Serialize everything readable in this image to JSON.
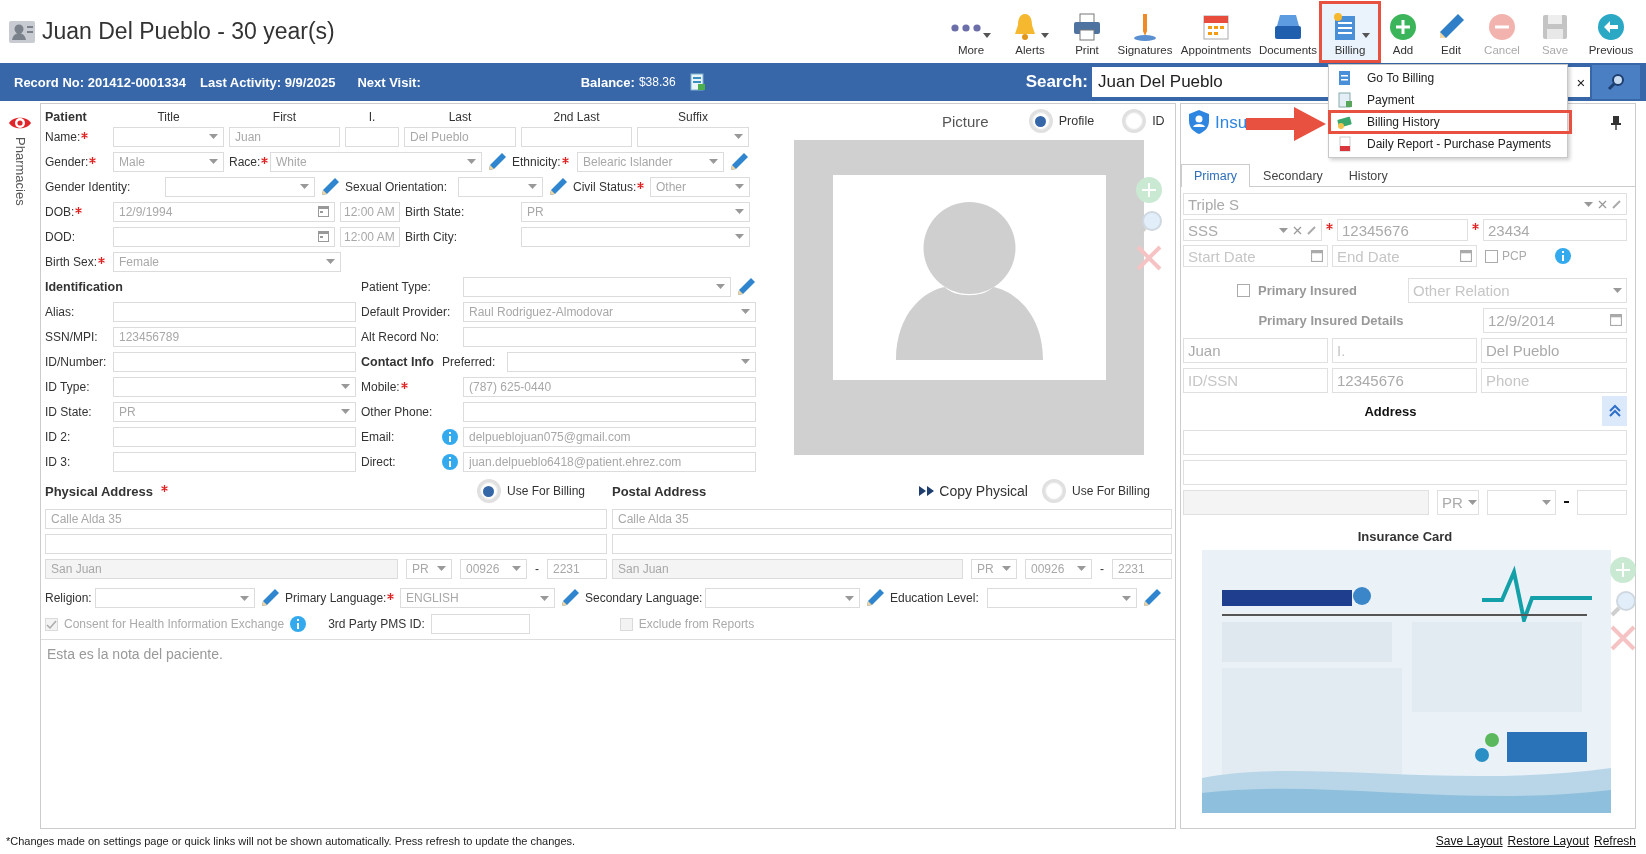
{
  "window": {
    "title": "Juan Del Pueblo - 30 year(s)"
  },
  "toolbar": [
    {
      "kind": "more",
      "label": "More",
      "caret": true,
      "disabled": false,
      "highlighted": false
    },
    {
      "kind": "alerts",
      "label": "Alerts",
      "caret": true,
      "disabled": false,
      "highlighted": false
    },
    {
      "kind": "print",
      "label": "Print",
      "caret": false,
      "disabled": false,
      "highlighted": false
    },
    {
      "kind": "signatures",
      "label": "Signatures",
      "caret": false,
      "disabled": false,
      "highlighted": false
    },
    {
      "kind": "appointments",
      "label": "Appointments",
      "caret": false,
      "disabled": false,
      "highlighted": false
    },
    {
      "kind": "documents",
      "label": "Documents",
      "caret": false,
      "disabled": false,
      "highlighted": false
    },
    {
      "kind": "billing",
      "label": "Billing",
      "caret": true,
      "disabled": false,
      "highlighted": true
    },
    {
      "kind": "add",
      "label": "Add",
      "caret": false,
      "disabled": false,
      "highlighted": false
    },
    {
      "kind": "edit",
      "label": "Edit",
      "caret": false,
      "disabled": false,
      "highlighted": false
    },
    {
      "kind": "cancel",
      "label": "Cancel",
      "caret": false,
      "disabled": true,
      "highlighted": false
    },
    {
      "kind": "save",
      "label": "Save",
      "caret": false,
      "disabled": true,
      "highlighted": false
    },
    {
      "kind": "previous",
      "label": "Previous",
      "caret": false,
      "disabled": false,
      "highlighted": false
    }
  ],
  "info_bar": {
    "record": "Record No: 201412-0001334",
    "activity": "Last Activity: 9/9/2025",
    "next_visit": "Next Visit:",
    "balance_label": "Balance:",
    "balance": "$38.36",
    "search_label": "Search:",
    "search_value": "Juan Del Pueblo",
    "clear": "×"
  },
  "billing_menu": [
    {
      "kind": "billing",
      "label": "Go To Billing",
      "highlighted": false
    },
    {
      "kind": "payment",
      "label": "Payment",
      "highlighted": false
    },
    {
      "kind": "history",
      "label": "Billing History",
      "highlighted": true
    },
    {
      "kind": "pdf",
      "label": "Daily Report - Purchase Payments",
      "highlighted": false
    }
  ],
  "annotation_arrow": true,
  "side_tab": {
    "label": "Pharmacies"
  },
  "patient_form": {
    "rows": [
      [
        {
          "kind": "heading",
          "text": "Patient"
        },
        {
          "kind": "column",
          "text": "Title"
        },
        {
          "kind": "column",
          "text": "First"
        },
        {
          "kind": "column",
          "text": "I."
        },
        {
          "kind": "column",
          "text": "Last"
        },
        {
          "kind": "column",
          "text": "2nd Last"
        },
        {
          "kind": "column",
          "text": "Suffix"
        }
      ],
      [
        {
          "kind": "label",
          "text": "Name:",
          "required": true
        },
        {
          "kind": "select"
        },
        {
          "kind": "text",
          "value": "Juan"
        },
        {
          "kind": "text"
        },
        {
          "kind": "text",
          "value": "Del Pueblo"
        },
        {
          "kind": "text"
        },
        {
          "kind": "select"
        }
      ],
      [
        {
          "kind": "label",
          "text": "Gender:",
          "required": true
        },
        {
          "kind": "select",
          "value": "Male"
        },
        {
          "kind": "label",
          "text": "Race:",
          "required": true
        },
        {
          "kind": "select",
          "value": "White"
        },
        {
          "kind": "edit"
        },
        {
          "kind": "label",
          "text": "Ethnicity:",
          "required": true
        },
        {
          "kind": "select",
          "value": "Belearic Islander"
        },
        {
          "kind": "edit"
        }
      ],
      [
        {
          "kind": "label",
          "text": "Gender Identity:",
          "required": false
        },
        {
          "kind": "select"
        },
        {
          "kind": "edit"
        },
        {
          "kind": "label",
          "text": "Sexual Orientation:",
          "required": false
        },
        {
          "kind": "select"
        },
        {
          "kind": "edit"
        },
        {
          "kind": "label",
          "text": "Civil Status:",
          "required": true
        },
        {
          "kind": "select",
          "value": "Other"
        }
      ],
      [
        {
          "kind": "label",
          "text": "DOB:",
          "required": true
        },
        {
          "kind": "date",
          "value": "12/9/1994"
        },
        {
          "kind": "time",
          "value": "12:00 AM"
        },
        {
          "kind": "label",
          "text": "Birth State:",
          "required": false
        },
        {
          "kind": "select",
          "value": "PR"
        }
      ],
      [
        {
          "kind": "label",
          "text": "DOD:",
          "required": false
        },
        {
          "kind": "date"
        },
        {
          "kind": "time",
          "value": "12:00 AM"
        },
        {
          "kind": "label",
          "text": "Birth City:",
          "required": false
        },
        {
          "kind": "select"
        }
      ],
      [
        {
          "kind": "label",
          "text": "Birth Sex:",
          "required": true
        },
        {
          "kind": "select",
          "value": "Female"
        }
      ]
    ],
    "identification": [
      [
        {
          "kind": "heading",
          "text": "Identification"
        }
      ],
      [
        {
          "kind": "label",
          "text": "Alias:",
          "required": false
        },
        {
          "kind": "text"
        }
      ],
      [
        {
          "kind": "label",
          "text": "SSN/MPI:",
          "required": false
        },
        {
          "kind": "text",
          "value": "123456789"
        }
      ],
      [
        {
          "kind": "label",
          "text": "ID/Number:",
          "required": false
        },
        {
          "kind": "text"
        }
      ],
      [
        {
          "kind": "label",
          "text": "ID Type:",
          "required": false
        },
        {
          "kind": "select"
        }
      ],
      [
        {
          "kind": "label",
          "text": "ID State:",
          "required": false
        },
        {
          "kind": "select",
          "value": "PR"
        }
      ],
      [
        {
          "kind": "label",
          "text": "ID 2:",
          "required": false
        },
        {
          "kind": "text"
        }
      ],
      [
        {
          "kind": "label",
          "text": "ID 3:",
          "required": false
        },
        {
          "kind": "text"
        }
      ]
    ],
    "contact": [
      [
        {
          "kind": "label",
          "text": "Patient Type:",
          "required": false
        },
        {
          "kind": "select"
        },
        {
          "kind": "edit"
        }
      ],
      [
        {
          "kind": "label",
          "text": "Default Provider:",
          "required": false
        },
        {
          "kind": "select",
          "value": "Raul Rodriguez-Almodovar"
        }
      ],
      [
        {
          "kind": "label",
          "text": "Alt Record No:",
          "required": false
        },
        {
          "kind": "text"
        }
      ],
      [
        {
          "kind": "heading",
          "text": "Contact Info"
        },
        {
          "kind": "label",
          "text": "Preferred:",
          "required": false
        },
        {
          "kind": "select"
        }
      ],
      [
        {
          "kind": "label",
          "text": "Mobile:",
          "required": true
        },
        {
          "kind": "text",
          "value": "(787) 625-0440"
        }
      ],
      [
        {
          "kind": "label",
          "text": "Other Phone:",
          "required": false
        },
        {
          "kind": "text"
        }
      ],
      [
        {
          "kind": "label",
          "text": "Email:",
          "required": false
        },
        {
          "kind": "info"
        },
        {
          "kind": "text",
          "value": "delpueblojuan075@gmail.com"
        }
      ],
      [
        {
          "kind": "label",
          "text": "Direct:",
          "required": false
        },
        {
          "kind": "info"
        },
        {
          "kind": "text",
          "value": "juan.delpueblo6418@patient.ehrez.com"
        }
      ]
    ]
  },
  "picture": {
    "title": "Picture",
    "options": [
      {
        "label": "Profile",
        "selected": true
      },
      {
        "label": "ID",
        "selected": false
      }
    ]
  },
  "addresses": [
    {
      "title": "Physical Address",
      "required": true,
      "use_for_billing": {
        "label": "Use For Billing",
        "selected": true
      },
      "street": "Calle Alda 35",
      "city": "San Juan",
      "state": "PR",
      "zip": "00926",
      "dash": "-",
      "zip4": "2231"
    },
    {
      "title": "Postal Address",
      "required": false,
      "copy_button": "Copy Physical",
      "use_for_billing": {
        "label": "Use For Billing",
        "selected": false
      },
      "street": "Calle Alda 35",
      "city": "San Juan",
      "state": "PR",
      "zip": "00926",
      "dash": "-",
      "zip4": "2231"
    }
  ],
  "language_row": [
    {
      "kind": "label",
      "text": "Religion:",
      "required": false
    },
    {
      "kind": "select"
    },
    {
      "kind": "edit"
    },
    {
      "kind": "label",
      "text": "Primary Language:",
      "required": true
    },
    {
      "kind": "select",
      "value": "ENGLISH"
    },
    {
      "kind": "edit"
    },
    {
      "kind": "label",
      "text": "Secondary Language:",
      "required": false
    },
    {
      "kind": "select"
    },
    {
      "kind": "edit"
    },
    {
      "kind": "label",
      "text": "Education Level:",
      "required": false
    },
    {
      "kind": "select"
    },
    {
      "kind": "edit"
    }
  ],
  "consent": {
    "label": "Consent for Health Information Exchange",
    "checked": true,
    "disabled": true
  },
  "pms_id": {
    "label": "3rd Party PMS ID:"
  },
  "exclude_reports": {
    "label": "Exclude from Reports",
    "checked": false,
    "disabled": true
  },
  "notes": {
    "value": "Esta es la nota del paciente."
  },
  "insurance": {
    "title": "Insu",
    "tabs": [
      {
        "label": "Primary",
        "selected": true
      },
      {
        "label": "Secondary",
        "selected": false
      },
      {
        "label": "History",
        "selected": false
      }
    ],
    "plan": "Triple S",
    "subplan": "SSS",
    "member_id": "12345676",
    "group_id": "23434",
    "start_date": {
      "placeholder": "Start Date"
    },
    "end_date": {
      "placeholder": "End Date"
    },
    "pcp": {
      "label": "PCP",
      "checked": false
    },
    "primary_insured": {
      "label": "Primary Insured",
      "checked": false
    },
    "relation": {
      "placeholder": "Other Relation"
    },
    "details_label": "Primary Insured Details",
    "insured_dob": "12/9/2014",
    "insured_first": "Juan",
    "insured_middle": {
      "placeholder": "I."
    },
    "insured_last": "Del Pueblo",
    "insured_id": {
      "placeholder": "ID/SSN"
    },
    "insured_ssn": "12345676",
    "insured_phone": {
      "placeholder": "Phone"
    },
    "address_label": "Address",
    "address_expanded": true,
    "address_state": "PR",
    "card_label": "Insurance Card"
  },
  "footer": {
    "note": "*Changes made on settings page or quick links will not be shown automatically. Press refresh to update the changes.",
    "links": [
      "Save Layout",
      "Restore Layout",
      "Refresh"
    ]
  }
}
